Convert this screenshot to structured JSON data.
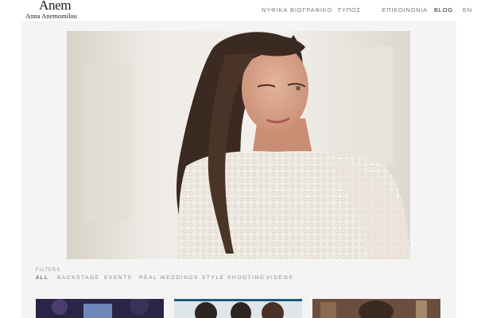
{
  "brand": {
    "logo_mark": "Anem",
    "name": "Anna Anemomilou"
  },
  "nav": {
    "items": [
      "ΝΥΦΙΚΑ",
      "ΒΙΟΓΡΑΦΙΚΟ",
      "ΤΥΠΟΣ",
      "ΕΠΙΚΟΙΝΩΝΙΑ",
      "BLOG",
      "EN"
    ]
  },
  "filters": {
    "label": "FILTERS",
    "items": [
      "ALL",
      "BACKSTAGE",
      "EVENTS",
      "REAL WEDDINGS",
      "STYLE SHOOTING",
      "VIDEOS"
    ],
    "active": "ALL"
  },
  "colors": {
    "panel": "#f4f4f4",
    "nav_text": "#777777",
    "active_text": "#222222"
  }
}
